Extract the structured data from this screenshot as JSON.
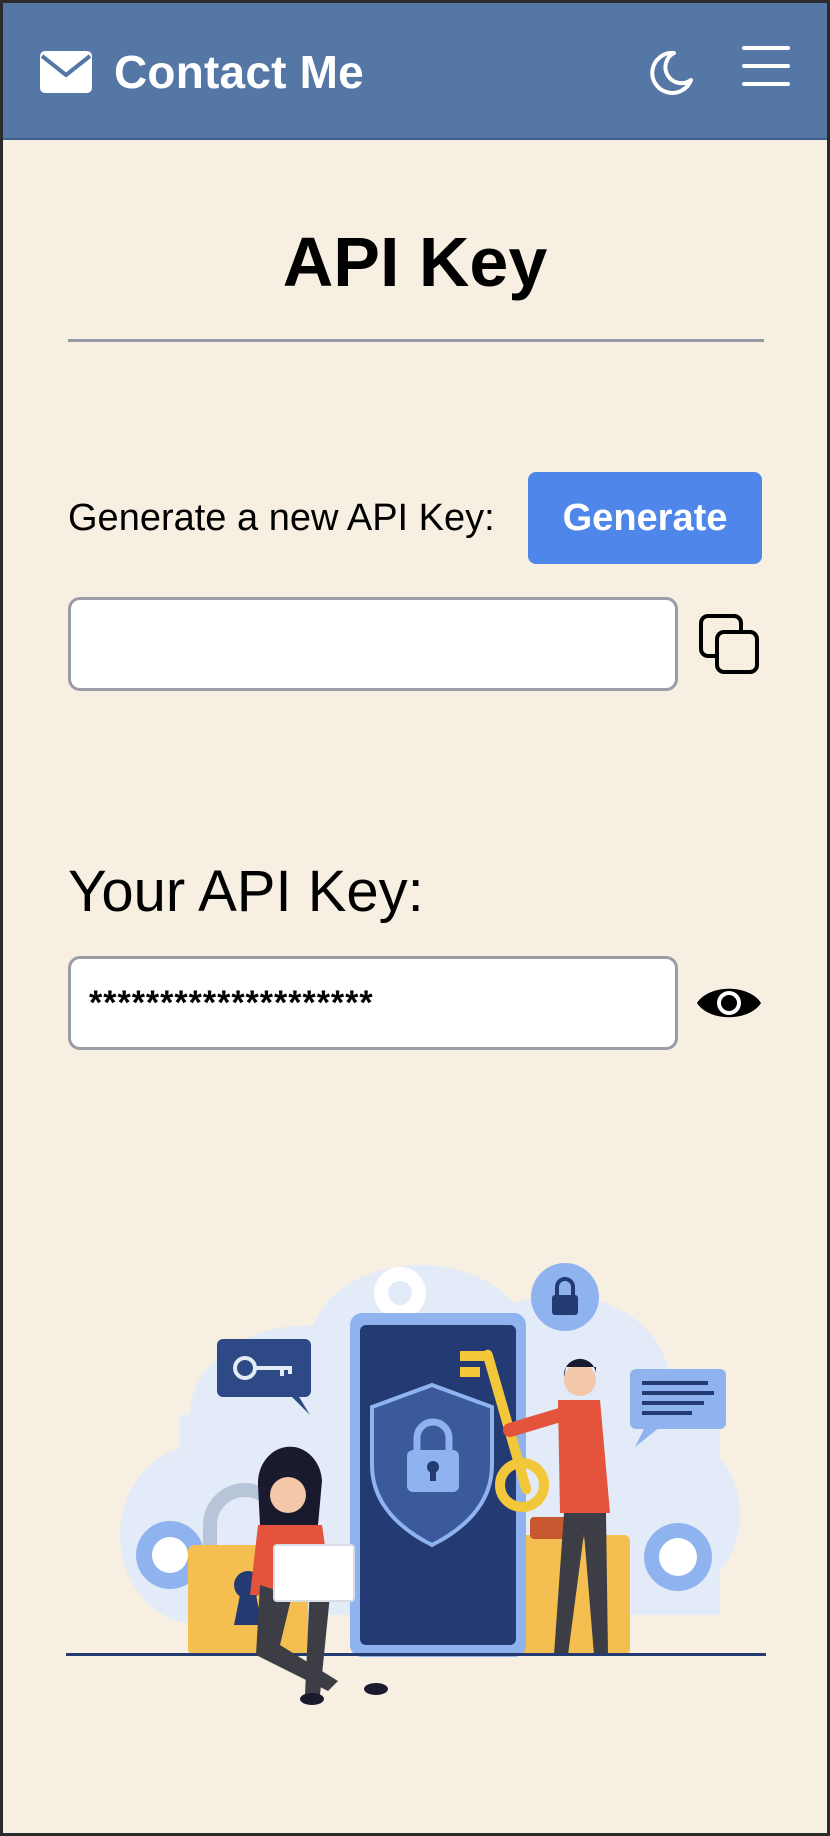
{
  "header": {
    "brand": "Contact Me",
    "brand_icon": "mail-icon",
    "theme_icon": "moon-icon",
    "menu_icon": "hamburger-menu-icon",
    "background_color": "#5577a5"
  },
  "main": {
    "title": "API Key",
    "generate": {
      "label": "Generate a new API Key:",
      "button_label": "Generate",
      "button_color": "#4f86ea",
      "new_key_value": "",
      "copy_icon": "copy-icon"
    },
    "current_key": {
      "label": "Your API Key:",
      "masked_value": "********************",
      "reveal_icon": "eye-icon"
    },
    "illustration": "security-key-illustration",
    "page_background": "#f6efe2"
  }
}
